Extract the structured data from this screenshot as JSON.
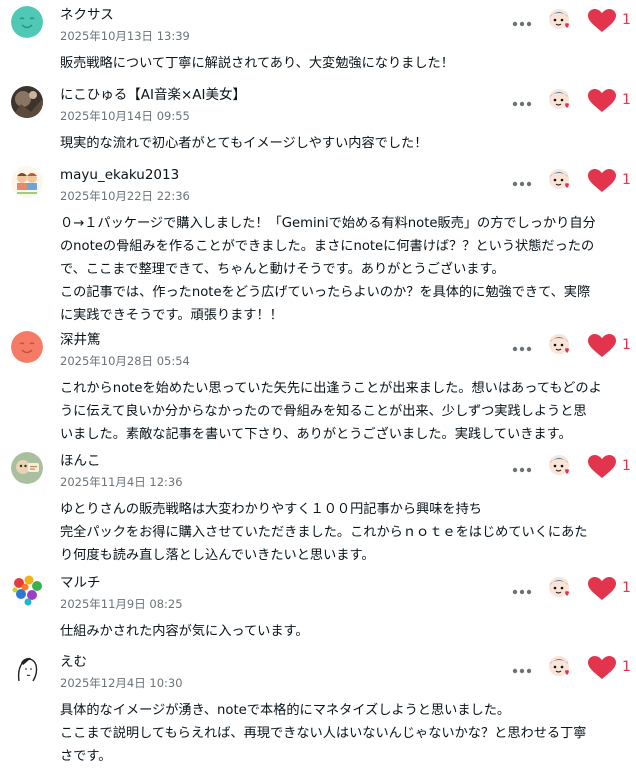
{
  "colors": {
    "like": "#e2344d",
    "text": "#08131a",
    "meta": "#6b7378"
  },
  "comments": [
    {
      "author": "ネクサス",
      "date": "2025年10月13日 13:39",
      "lines": [
        "販売戦略について丁寧に解説されてあり、大変勉強になりました！"
      ],
      "likes": "1",
      "avatar_icon": "default-face-avatar"
    },
    {
      "author": "にこひゅる【AI音楽×AI美女】",
      "date": "2025年10月14日 09:55",
      "lines": [
        "現実的な流れで初心者がとてもイメージしやすい内容でした！"
      ],
      "likes": "1",
      "avatar_icon": "photo-avatar"
    },
    {
      "author": "mayu_ekaku2013",
      "date": "2025年10月22日 22:36",
      "lines": [
        "０→１パッケージで購入しました！「Geminiで始める有料note販売」の方でしっかり自分",
        "のnoteの骨組みを作ることができました。まさにnoteに何書けば？？という状態だったの",
        "で、ここまで整理できて、ちゃんと動けそうです。ありがとうございます。",
        "この記事では、作ったnoteをどう広げていったらよいのか？を具体的に勉強できて、実際",
        "に実践できそうです。頑張ります！！"
      ],
      "likes": "1",
      "avatar_icon": "illustration-avatar"
    },
    {
      "author": "深井篤",
      "date": "2025年10月28日 05:54",
      "lines": [
        "これからnoteを始めたい思っていた矢先に出逢うことが出来ました。想いはあってもどのよ",
        "うに伝えて良いか分からなかったので骨組みを知ることが出来、少しずつ実践しようと思",
        "いました。素敵な記事を書いて下さり、ありがとうございました。実践していきます。"
      ],
      "likes": "1",
      "avatar_icon": "default-face-avatar"
    },
    {
      "author": "ほんこ",
      "date": "2025年11月4日 12:36",
      "lines": [
        "ゆとりさんの販売戦略は大変わかりやすく１００円記事から興味を持ち",
        "完全パックをお得に購入させていただきました。これからｎｏｔｅをはじめていくにあた",
        "り何度も読み直し落とし込んでいきたいと思います。"
      ],
      "likes": "1",
      "avatar_icon": "illustration-avatar"
    },
    {
      "author": "マルチ",
      "date": "2025年11月9日 08:25",
      "lines": [
        "仕組みかされた内容が気に入っています。"
      ],
      "likes": "1",
      "avatar_icon": "colorful-dots-avatar"
    },
    {
      "author": "えむ",
      "date": "2025年12月4日 10:30",
      "lines": [
        "具体的なイメージが湧き、noteで本格的にマネタイズしようと思いました。",
        "ここまで説明してもらえれば、再現できない人はいないんじゃないかな？と思わせる丁寧",
        "さです。"
      ],
      "likes": "1",
      "avatar_icon": "line-drawing-avatar"
    }
  ]
}
